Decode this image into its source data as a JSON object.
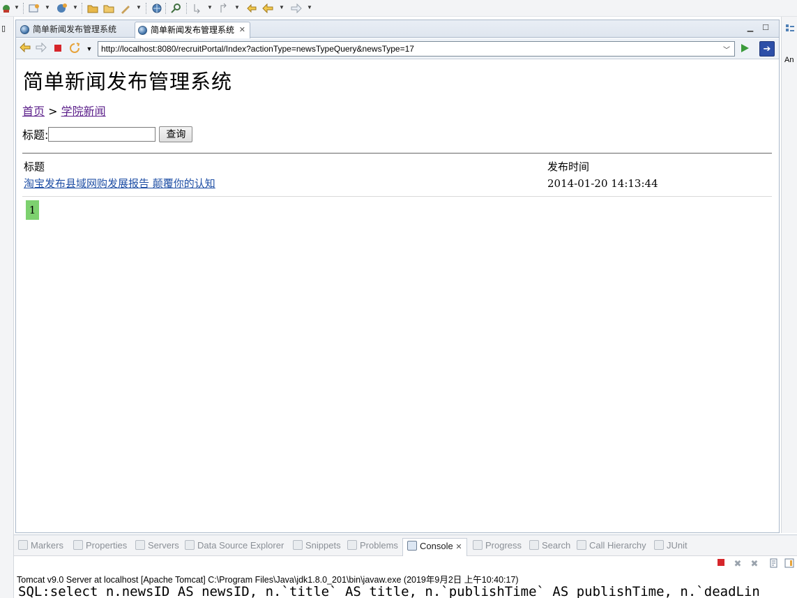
{
  "toolbar": {
    "icons": [
      "debug-icon",
      "new-server-icon",
      "globe-run-icon",
      "open-folder-icon",
      "open-type-icon",
      "tasks-icon",
      "web-browser-icon",
      "search-icon",
      "next-annotation-icon",
      "prev-annotation-icon",
      "back-icon",
      "forward-icon"
    ]
  },
  "editor": {
    "tabs": [
      {
        "label": "简单新闻发布管理系统"
      },
      {
        "label": "简单新闻发布管理系统"
      }
    ]
  },
  "browser": {
    "url": "http://localhost:8080/recruitPortal/Index?actionType=newsTypeQuery&newsType=17"
  },
  "right_trim": {
    "label": "An"
  },
  "page": {
    "title": "简单新闻发布管理系统",
    "breadcrumb": {
      "home": "首页",
      "separator": ">",
      "current": "学院新闻"
    },
    "search": {
      "label": "标题:",
      "value": "",
      "button": "查询"
    },
    "table": {
      "headers": [
        "标题",
        "发布时间"
      ],
      "rows": [
        {
          "title": "淘宝发布县域网购发展报告 颠覆你的认知",
          "time": "2014-01-20 14:13:44"
        }
      ]
    },
    "pagination": [
      "1"
    ],
    "colors": {
      "link": "#1f4fa5",
      "visited": "#5b1f8a",
      "active_page": "#7dd16f"
    }
  },
  "bottom": {
    "tabs": [
      {
        "label": "Markers"
      },
      {
        "label": "Properties"
      },
      {
        "label": "Servers"
      },
      {
        "label": "Data Source Explorer"
      },
      {
        "label": "Snippets"
      },
      {
        "label": "Problems"
      },
      {
        "label": "Console"
      },
      {
        "label": "Progress"
      },
      {
        "label": "Search"
      },
      {
        "label": "Call Hierarchy"
      },
      {
        "label": "JUnit"
      }
    ],
    "console": {
      "status": "Tomcat v9.0 Server at localhost [Apache Tomcat] C:\\Program Files\\Java\\jdk1.8.0_201\\bin\\javaw.exe (2019年9月2日 上午10:40:17)",
      "line": "SQL:select n.newsID AS newsID, n.`title` AS title, n.`publishTime` AS publishTime, n.`deadLin"
    }
  }
}
